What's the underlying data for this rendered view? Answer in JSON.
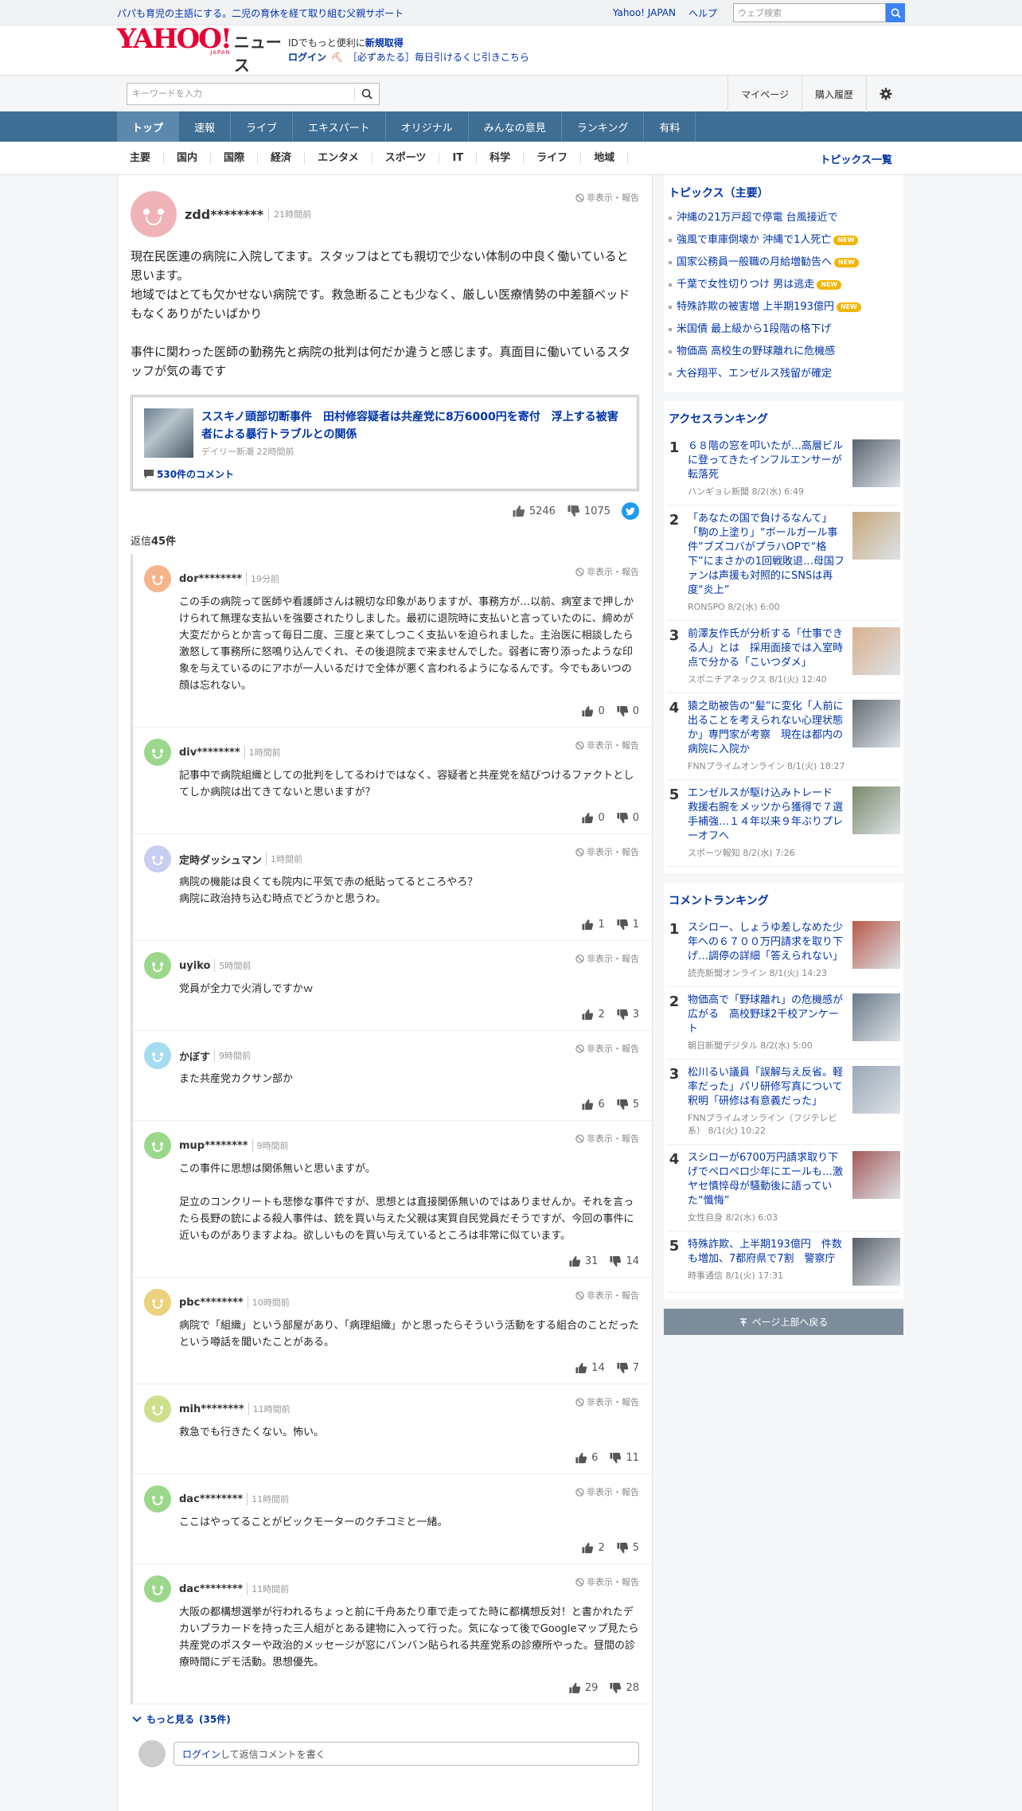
{
  "topbar": {
    "promo": "パパも育児の主語にする。二児の育休を経て取り組む父親サポート",
    "yahoo_japan": "Yahoo! JAPAN",
    "help": "ヘルプ",
    "web_search_placeholder": "ウェブ検索"
  },
  "header": {
    "logo": "YAHOO!",
    "logo_sub": "JAPAN",
    "logo_news": "ニュース",
    "line1_prefix": "IDでもっと便利に",
    "line1_link": "新規取得",
    "login": "ログイン",
    "lottery": "［必ずあたる］毎日引けるくじ引きこちら"
  },
  "subheader": {
    "keyword_placeholder": "キーワードを入力",
    "mypage": "マイページ",
    "history": "購入履歴"
  },
  "global_nav": [
    "トップ",
    "速報",
    "ライブ",
    "エキスパート",
    "オリジナル",
    "みんなの意見",
    "ランキング",
    "有料"
  ],
  "category_nav": [
    "主要",
    "国内",
    "国際",
    "経済",
    "エンタメ",
    "スポーツ",
    "IT",
    "科学",
    "ライフ",
    "地域"
  ],
  "topics_list_link": "トピックス一覧",
  "comment": {
    "user": "zdd********",
    "time": "21時間前",
    "hide_report": "非表示・報告",
    "text1": "現在民医連の病院に入院してます。スタッフはとても親切で少ない体制の中良く働いていると思います。",
    "text2": "地域ではとても欠かせない病院です。救急断ることも少なく、厳しい医療情勢の中差額ベッドもなくありがたいばかり",
    "text3": "事件に関わった医師の勤務先と病院の批判は何だか違うと感じます。真面目に働いているスタッフが気の毒です",
    "article": {
      "title": "ススキノ頭部切断事件　田村修容疑者は共産党に8万6000円を寄付　浮上する被害者による暴行トラブルとの関係",
      "meta": "デイリー新潮 22時間前",
      "comments": "530件のコメント"
    },
    "likes": "5246",
    "dislikes": "1075",
    "replies_label": "返信",
    "replies_count": "45件"
  },
  "replies": [
    {
      "user": "dor********",
      "time": "19分前",
      "color": "#f5b48c",
      "text": "この手の病院って医師や看護師さんは親切な印象がありますが、事務方が…以前、病室まで押しかけられて無理な支払いを強要されたりしました。最初に退院時に支払いと言っていたのに、締めが大変だからとか言って毎日二度、三度と来てしつこく支払いを迫られました。主治医に相談したら激怒して事務所に怒鳴り込んでくれ、その後退院まで来ませんでした。弱者に寄り添ったような印象を与えているのにアホが一人いるだけで全体が悪く言われるようになるんです。今でもあいつの顔は忘れない。",
      "likes": "0",
      "dislikes": "0"
    },
    {
      "user": "div********",
      "time": "1時間前",
      "color": "#9cd88c",
      "text": "記事中で病院組織としての批判をしてるわけではなく、容疑者と共産党を結びつけるファクトとしてしか病院は出てきてないと思いますが？",
      "likes": "0",
      "dislikes": "0"
    },
    {
      "user": "定時ダッシュマン",
      "time": "1時間前",
      "color": "#c8cdf2",
      "text": "病院の機能は良くても院内に平気で赤の紙貼ってるところやろ？\n病院に政治持ち込む時点でどうかと思うわ。",
      "likes": "1",
      "dislikes": "1"
    },
    {
      "user": "uyiko",
      "time": "5時間前",
      "color": "#9cd88c",
      "text": "党員が全力で火消しですかｗ",
      "likes": "2",
      "dislikes": "3"
    },
    {
      "user": "かぼす",
      "time": "9時間前",
      "color": "#a6dcf0",
      "text": "また共産党カクサン部か",
      "likes": "6",
      "dislikes": "5"
    },
    {
      "user": "mup********",
      "time": "9時間前",
      "color": "#9cd88c",
      "text": "この事件に思想は関係無いと思いますが。\n\n足立のコンクリートも悲惨な事件ですが、思想とは直接関係無いのではありませんか。それを言ったら長野の銃による殺人事件は、銃を買い与えた父親は実質自民党員だそうですが、今回の事件に近いものがありますよね。欲しいものを買い与えているところは非常に似ています。",
      "likes": "31",
      "dislikes": "14"
    },
    {
      "user": "pbc********",
      "time": "10時間前",
      "color": "#ecd27c",
      "text": "病院で「組織」という部屋があり、「病理組織」かと思ったらそういう活動をする組合のことだったという噂話を聞いたことがある。",
      "likes": "14",
      "dislikes": "7"
    },
    {
      "user": "mih********",
      "time": "11時間前",
      "color": "#cce08c",
      "text": "救急でも行きたくない。怖い。",
      "likes": "6",
      "dislikes": "11"
    },
    {
      "user": "dac********",
      "time": "11時間前",
      "color": "#9cd88c",
      "text": "ここはやってることがビックモーターのクチコミと一緒。",
      "likes": "2",
      "dislikes": "5"
    },
    {
      "user": "dac********",
      "time": "11時間前",
      "color": "#9cd88c",
      "text": "大阪の都構想選挙が行われるちょっと前に千舟あたり車で走ってた時に都構想反対！と書かれたデカいプラカードを持った三人組がとある建物に入って行った。気になって後でGoogleマップ見たら共産党のポスターや政治的メッセージが窓にバンバン貼られる共産党系の診療所やった。昼間の診療時間にデモ活動。思想優先。",
      "likes": "29",
      "dislikes": "28"
    }
  ],
  "more_label": "もっと見る",
  "more_count": "(35件)",
  "reply_box": {
    "login": "ログイン",
    "rest": "して返信コメントを書く"
  },
  "sidebar": {
    "topics_header": "トピックス（主要）",
    "topics": [
      {
        "title": "沖縄の21万戸超で停電 台風接近で",
        "new": ""
      },
      {
        "title": "強風で車庫倒壊か 沖縄で1人死亡",
        "new": "NEW"
      },
      {
        "title": "国家公務員一般職の月給増勧告へ",
        "new": "NEW"
      },
      {
        "title": "千葉で女性切りつけ 男は逃走",
        "new": "NEW"
      },
      {
        "title": "特殊詐欺の被害増 上半期193億円",
        "new": "NEW"
      },
      {
        "title": "米国債 最上級から1段階の格下げ",
        "new": ""
      },
      {
        "title": "物価高 高校生の野球離れに危機感",
        "new": ""
      },
      {
        "title": "大谷翔平、エンゼルス残留が確定",
        "new": ""
      }
    ],
    "access_header": "アクセスランキング",
    "access": [
      {
        "num": "1",
        "title": "６８階の窓を叩いたが…高層ビルに登ってきたインフルエンサーが転落死",
        "src": "ハンギョレ新聞 8/2(水) 6:49",
        "thumb": "#5a6470"
      },
      {
        "num": "2",
        "title": "「あなたの国で負けるなんて」「駒の上塗り」“ボールガール事件”ブズコバがプラハOPで“格下”にまさかの1回戦敗退…母国ファンは声援も対照的にSNSは再度“炎上”",
        "src": "RONSPO 8/2(水) 6:00",
        "thumb": "#c8a87a"
      },
      {
        "num": "3",
        "title": "前澤友作氏が分析する「仕事できる人」とは　採用面接では入室時点で分かる「こいつダメ」",
        "src": "スポニチアネックス 8/1(火) 12:40",
        "thumb": "#d9b08c"
      },
      {
        "num": "4",
        "title": "猿之助被告の“髪”に変化「人前に出ることを考えられない心理状態か」専門家が考察　現在は都内の病院に入院か",
        "src": "FNNプライムオンライン 8/1(火) 18:27",
        "thumb": "#666e74"
      },
      {
        "num": "5",
        "title": "エンゼルスが駆け込みトレード　救援右腕をメッツから獲得で７選手補強…１４年以来９年ぶりプレーオフへ",
        "src": "スポーツ報知 8/2(水) 7:26",
        "thumb": "#7a8a6a"
      }
    ],
    "comment_header": "コメントランキング",
    "comment_rank": [
      {
        "num": "1",
        "title": "スシロー、しょうゆ差しなめた少年への６７００万円請求を取り下げ…調停の詳細「答えられない」",
        "src": "読売新聞オンライン 8/1(火) 14:23",
        "thumb": "#b85a4a"
      },
      {
        "num": "2",
        "title": "物価高で「野球離れ」の危機感が広がる　高校野球2千校アンケート",
        "src": "朝日新聞デジタル 8/2(水) 5:00",
        "thumb": "#6a7a8a"
      },
      {
        "num": "3",
        "title": "松川るい議員「誤解与え反省。軽率だった」パリ研修写真について釈明「研修は有意義だった」",
        "src": "FNNプライムオンライン（フジテレビ系） 8/1(火) 10:22",
        "thumb": "#9aa8b8"
      },
      {
        "num": "4",
        "title": "スシローが6700万円請求取り下げでペロペロ少年にエールも…激ヤセ慎悴母が騒動後に語っていた“懺悔”",
        "src": "女性自身 8/2(水) 6:03",
        "thumb": "#a45a5a"
      },
      {
        "num": "5",
        "title": "特殊詐欺、上半期193億円　件数も増加、7都府県で7割　警察庁",
        "src": "時事通信 8/1(火) 17:31",
        "thumb": "#5a6068"
      }
    ],
    "back_to_top": "ページ上部へ戻る"
  }
}
